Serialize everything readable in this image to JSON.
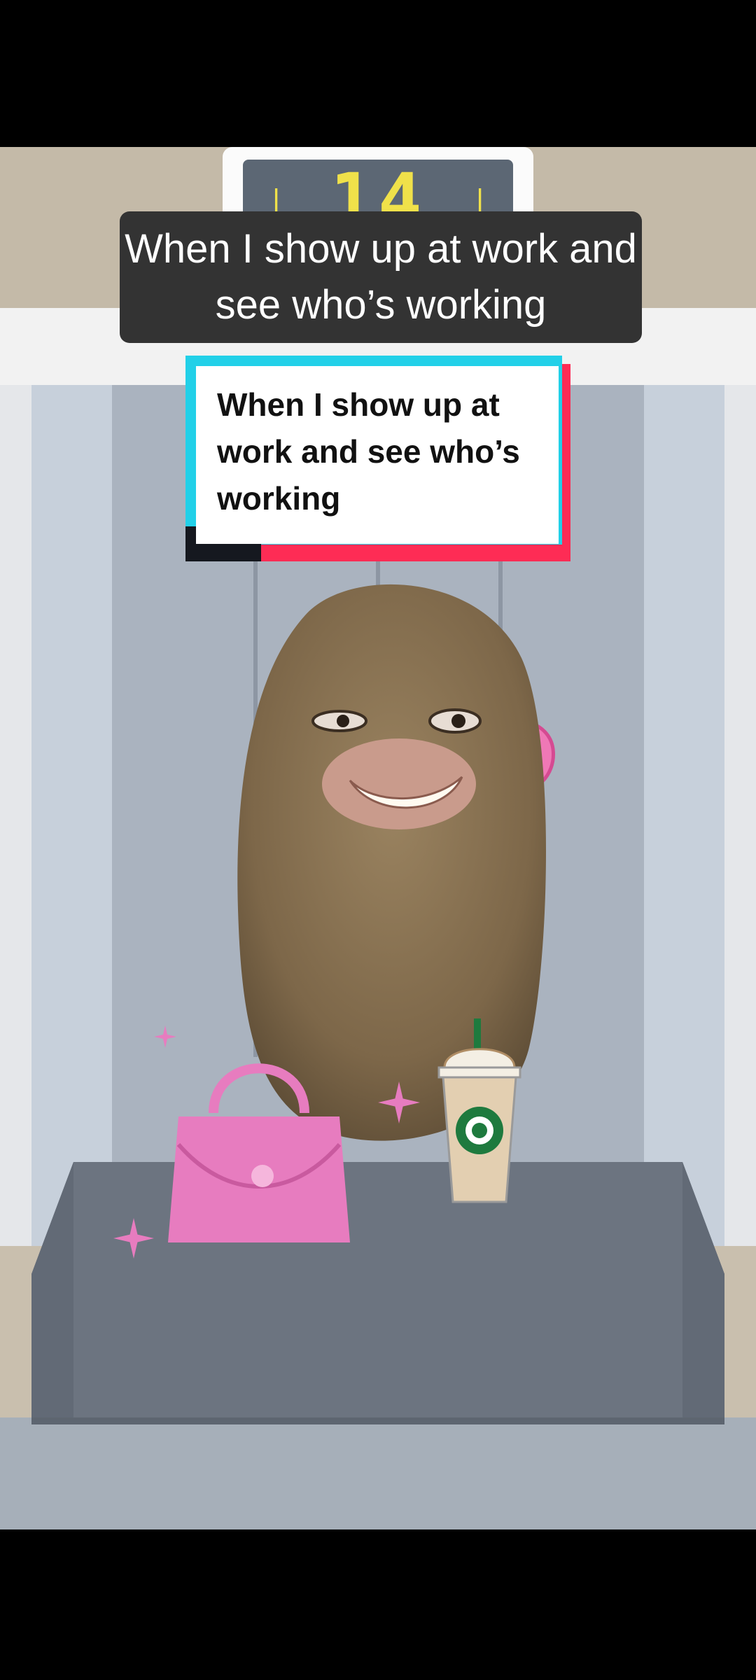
{
  "elevator": {
    "floor": "14",
    "arrow_left": "↓",
    "arrow_right": "↓"
  },
  "caption": {
    "text": "When I show up at work and see who’s working"
  },
  "tiktok_card": {
    "text": "When I show up at work and see who’s working"
  },
  "stickers": {
    "bow": "pink-bow",
    "handbag": "pink-handbag",
    "drink": "coffee-frappuccino",
    "sparkles": "pink-sparkles"
  },
  "colors": {
    "caption_bg": "#333333",
    "indicator_bg": "#5c6774",
    "indicator_digits": "#f0e14a",
    "tiktok_cyan": "#22d0e8",
    "tiktok_red": "#fe2c55",
    "sticker_pink": "#e77cbf"
  }
}
